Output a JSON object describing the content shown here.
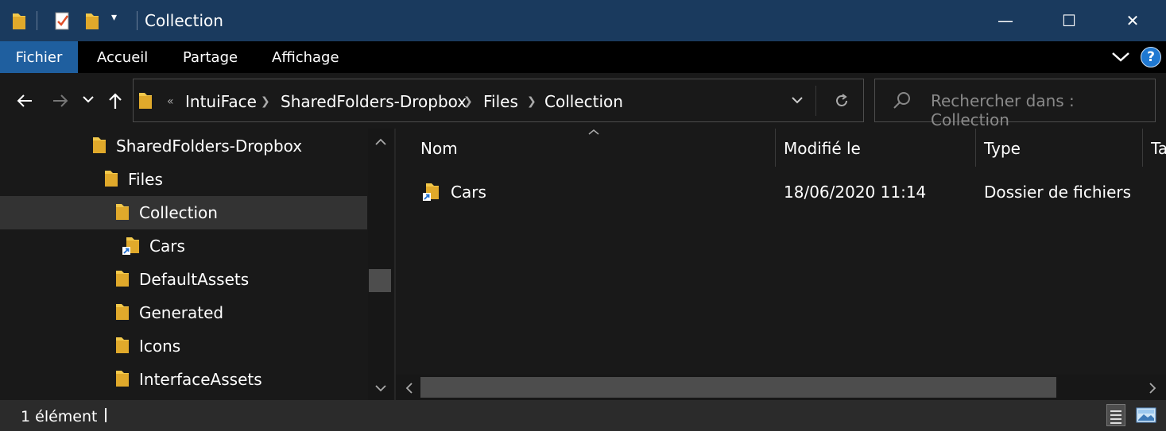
{
  "window": {
    "title": "Collection",
    "minimize_glyph": "—",
    "maximize_glyph": "☐",
    "close_glyph": "✕"
  },
  "ribbon": {
    "tabs": [
      "Fichier",
      "Accueil",
      "Partage",
      "Affichage"
    ],
    "help_label": "?"
  },
  "address": {
    "overflow": "«",
    "crumbs": [
      "IntuiFace",
      "SharedFolders-Dropbox",
      "Files",
      "Collection"
    ],
    "search_placeholder": "Rechercher dans : Collection"
  },
  "nav": {
    "items": [
      {
        "label": "SharedFolders-Dropbox",
        "level": 0,
        "shortcut": false,
        "selected": false
      },
      {
        "label": "Files",
        "level": 1,
        "shortcut": false,
        "selected": false
      },
      {
        "label": "Collection",
        "level": 2,
        "shortcut": false,
        "selected": true
      },
      {
        "label": "Cars",
        "level": 3,
        "shortcut": true,
        "selected": false
      },
      {
        "label": "DefaultAssets",
        "level": 2,
        "shortcut": false,
        "selected": false
      },
      {
        "label": "Generated",
        "level": 2,
        "shortcut": false,
        "selected": false
      },
      {
        "label": "Icons",
        "level": 2,
        "shortcut": false,
        "selected": false
      },
      {
        "label": "InterfaceAssets",
        "level": 2,
        "shortcut": false,
        "selected": false
      }
    ]
  },
  "content": {
    "columns": [
      "Nom",
      "Modifié le",
      "Type",
      "Ta"
    ],
    "rows": [
      {
        "name": "Cars",
        "modified": "18/06/2020 11:14",
        "type": "Dossier de fichiers"
      }
    ]
  },
  "status": {
    "item_count": "1 élément"
  },
  "colors": {
    "title_bar": "#1a3a5e",
    "file_tab": "#1f5f9f",
    "folder_yellow": "#f2c84b",
    "selection": "#333333"
  }
}
